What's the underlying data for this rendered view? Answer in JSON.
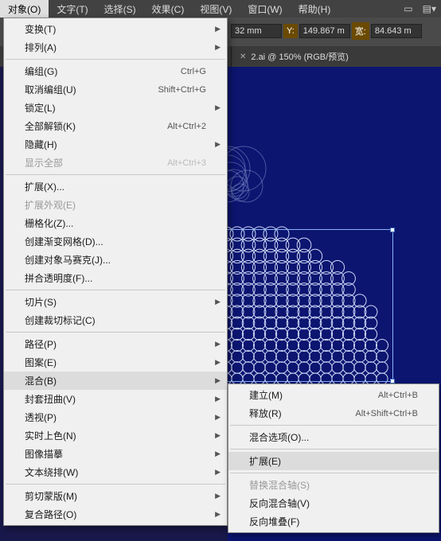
{
  "menubar": {
    "items": [
      {
        "label": "对象(O)"
      },
      {
        "label": "文字(T)"
      },
      {
        "label": "选择(S)"
      },
      {
        "label": "效果(C)"
      },
      {
        "label": "视图(V)"
      },
      {
        "label": "窗口(W)"
      },
      {
        "label": "帮助(H)"
      }
    ]
  },
  "control": {
    "x_mm": "32 mm",
    "y_label": "Y:",
    "y_val": "149.867 m",
    "w_label": "宽:",
    "w_val": "84.643 m"
  },
  "tab": {
    "title": "2.ai @ 150% (RGB/预览)"
  },
  "menu": {
    "groups": [
      [
        {
          "label": "变换(T)",
          "sub": true
        },
        {
          "label": "排列(A)",
          "sub": true
        }
      ],
      [
        {
          "label": "编组(G)",
          "shortcut": "Ctrl+G"
        },
        {
          "label": "取消编组(U)",
          "shortcut": "Shift+Ctrl+G"
        },
        {
          "label": "锁定(L)",
          "sub": true
        },
        {
          "label": "全部解锁(K)",
          "shortcut": "Alt+Ctrl+2"
        },
        {
          "label": "隐藏(H)",
          "sub": true
        },
        {
          "label": "显示全部",
          "shortcut": "Alt+Ctrl+3",
          "disabled": true
        }
      ],
      [
        {
          "label": "扩展(X)..."
        },
        {
          "label": "扩展外观(E)",
          "disabled": true
        },
        {
          "label": "栅格化(Z)..."
        },
        {
          "label": "创建渐变网格(D)..."
        },
        {
          "label": "创建对象马赛克(J)..."
        },
        {
          "label": "拼合透明度(F)..."
        }
      ],
      [
        {
          "label": "切片(S)",
          "sub": true
        },
        {
          "label": "创建裁切标记(C)"
        }
      ],
      [
        {
          "label": "路径(P)",
          "sub": true
        },
        {
          "label": "图案(E)",
          "sub": true
        },
        {
          "label": "混合(B)",
          "sub": true,
          "hl": true
        },
        {
          "label": "封套扭曲(V)",
          "sub": true
        },
        {
          "label": "透视(P)",
          "sub": true
        },
        {
          "label": "实时上色(N)",
          "sub": true
        },
        {
          "label": "图像描摹",
          "sub": true
        },
        {
          "label": "文本绕排(W)",
          "sub": true
        }
      ],
      [
        {
          "label": "剪切蒙版(M)",
          "sub": true
        },
        {
          "label": "复合路径(O)",
          "sub": true
        }
      ]
    ]
  },
  "submenu": {
    "groups": [
      [
        {
          "label": "建立(M)",
          "shortcut": "Alt+Ctrl+B"
        },
        {
          "label": "释放(R)",
          "shortcut": "Alt+Shift+Ctrl+B"
        }
      ],
      [
        {
          "label": "混合选项(O)..."
        }
      ],
      [
        {
          "label": "扩展(E)",
          "hl": true
        }
      ],
      [
        {
          "label": "替换混合轴(S)",
          "disabled": true
        },
        {
          "label": "反向混合轴(V)"
        },
        {
          "label": "反向堆叠(F)"
        }
      ]
    ]
  }
}
